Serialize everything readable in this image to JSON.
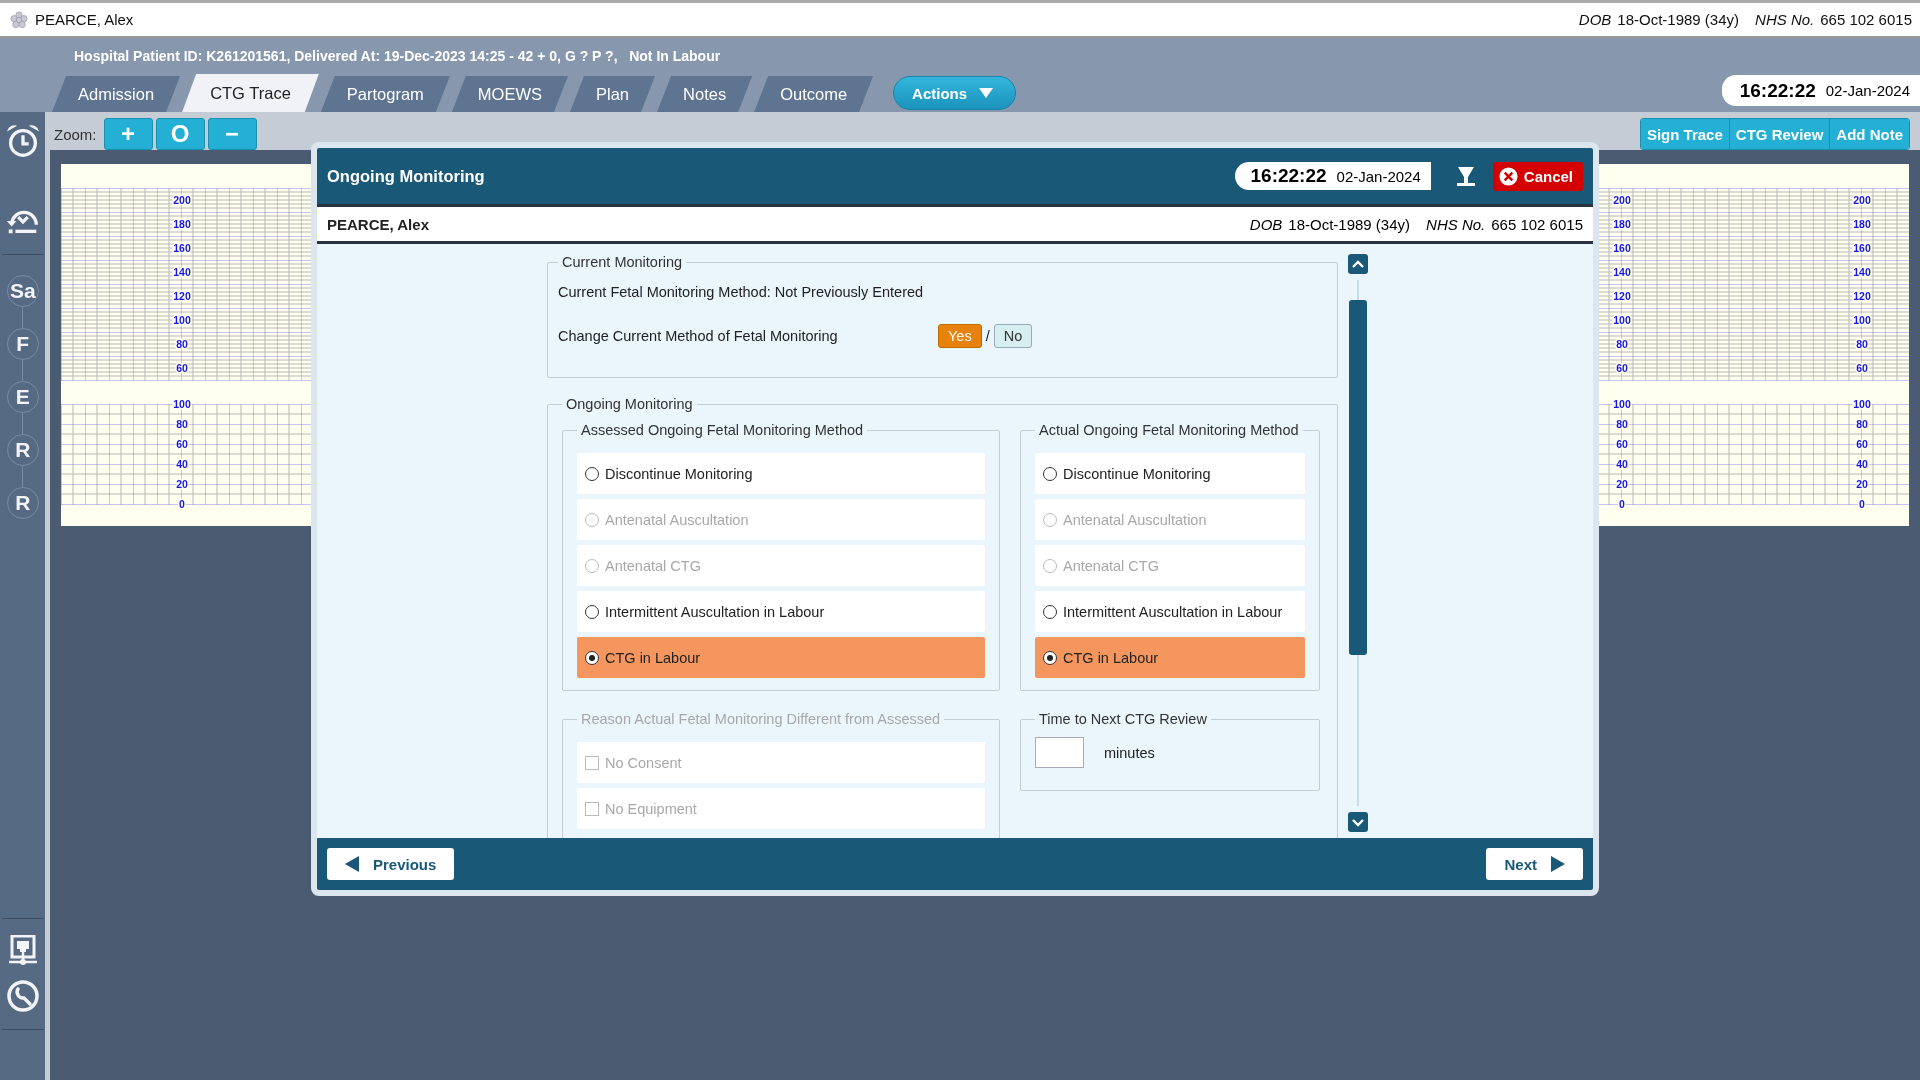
{
  "patient_bar": {
    "name": "PEARCE, Alex",
    "dob_label": "DOB",
    "dob": "18-Oct-1989 (34y)",
    "nhs_label": "NHS No.",
    "nhs": "665 102 6015"
  },
  "header": {
    "info": "Hospital Patient ID: K261201561, Delivered At: 19-Dec-2023 14:25 - 42 + 0, G ? P ?,   Not In Labour",
    "tabs": [
      {
        "label": "Admission",
        "selected": false
      },
      {
        "label": "CTG Trace",
        "selected": true
      },
      {
        "label": "Partogram",
        "selected": false
      },
      {
        "label": "MOEWS",
        "selected": false
      },
      {
        "label": "Plan",
        "selected": false
      },
      {
        "label": "Notes",
        "selected": false
      },
      {
        "label": "Outcome",
        "selected": false
      }
    ],
    "actions": "Actions",
    "clock": {
      "time": "16:22:22",
      "date": "02-Jan-2024"
    }
  },
  "toolbar": {
    "zoom_label": "Zoom:",
    "zoom_buttons": [
      "+",
      "O",
      "−"
    ],
    "buttons": [
      "Sign Trace",
      "CTG Review",
      "Add Note"
    ]
  },
  "sidebar": {
    "letters": [
      "Sa",
      "F",
      "E",
      "R",
      "R"
    ]
  },
  "trace": {
    "axes": [
      {
        "upper": [
          "200",
          "180",
          "160",
          "140",
          "120",
          "100",
          "80",
          "60"
        ],
        "lower": [
          "100",
          "80",
          "60",
          "40",
          "20",
          "0"
        ]
      },
      {
        "upper": [
          "200",
          "180",
          "160",
          "140",
          "120",
          "100",
          "80",
          "60"
        ],
        "lower": [
          "100",
          "80",
          "60",
          "40",
          "20",
          "0"
        ]
      },
      {
        "upper": [
          "200",
          "180",
          "160",
          "140",
          "120",
          "100",
          "80",
          "60"
        ],
        "lower": [
          "100",
          "80",
          "60",
          "40",
          "20",
          "0"
        ]
      }
    ]
  },
  "dialog": {
    "title": "Ongoing Monitoring",
    "clock": {
      "time": "16:22:22",
      "date": "02-Jan-2024"
    },
    "cancel": "Cancel",
    "patient": {
      "name": "PEARCE, Alex",
      "dob_label": "DOB",
      "dob": "18-Oct-1989 (34y)",
      "nhs_label": "NHS No.",
      "nhs": "665 102 6015"
    },
    "current": {
      "legend": "Current Monitoring",
      "method_text": "Current Fetal Monitoring Method: Not Previously Entered",
      "change_label": "Change Current Method of Fetal Monitoring",
      "separator": "/",
      "options": [
        {
          "label": "Yes",
          "selected": true
        },
        {
          "label": "No",
          "selected": false
        }
      ]
    },
    "ongoing": {
      "legend": "Ongoing Monitoring",
      "groups": [
        {
          "legend": "Assessed Ongoing Fetal Monitoring Method",
          "options": [
            {
              "label": "Discontinue Monitoring",
              "selected": false,
              "disabled": false
            },
            {
              "label": "Antenatal Auscultation",
              "selected": false,
              "disabled": true
            },
            {
              "label": "Antenatal CTG",
              "selected": false,
              "disabled": true
            },
            {
              "label": "Intermittent Auscultation in Labour",
              "selected": false,
              "disabled": false
            },
            {
              "label": "CTG in Labour",
              "selected": true,
              "disabled": false
            }
          ]
        },
        {
          "legend": "Actual Ongoing Fetal Monitoring Method",
          "options": [
            {
              "label": "Discontinue Monitoring",
              "selected": false,
              "disabled": false
            },
            {
              "label": "Antenatal Auscultation",
              "selected": false,
              "disabled": true
            },
            {
              "label": "Antenatal CTG",
              "selected": false,
              "disabled": true
            },
            {
              "label": "Intermittent Auscultation in Labour",
              "selected": false,
              "disabled": false
            },
            {
              "label": "CTG in Labour",
              "selected": true,
              "disabled": false
            }
          ]
        }
      ],
      "reason": {
        "legend": "Reason Actual Fetal Monitoring Different from Assessed",
        "disabled": true,
        "options": [
          {
            "label": "No Consent",
            "checked": false,
            "disabled": true
          },
          {
            "label": "No Equipment",
            "checked": false,
            "disabled": true
          }
        ]
      },
      "review": {
        "legend": "Time to Next CTG Review",
        "unit": "minutes"
      }
    },
    "previous": "Previous",
    "next": "Next"
  }
}
